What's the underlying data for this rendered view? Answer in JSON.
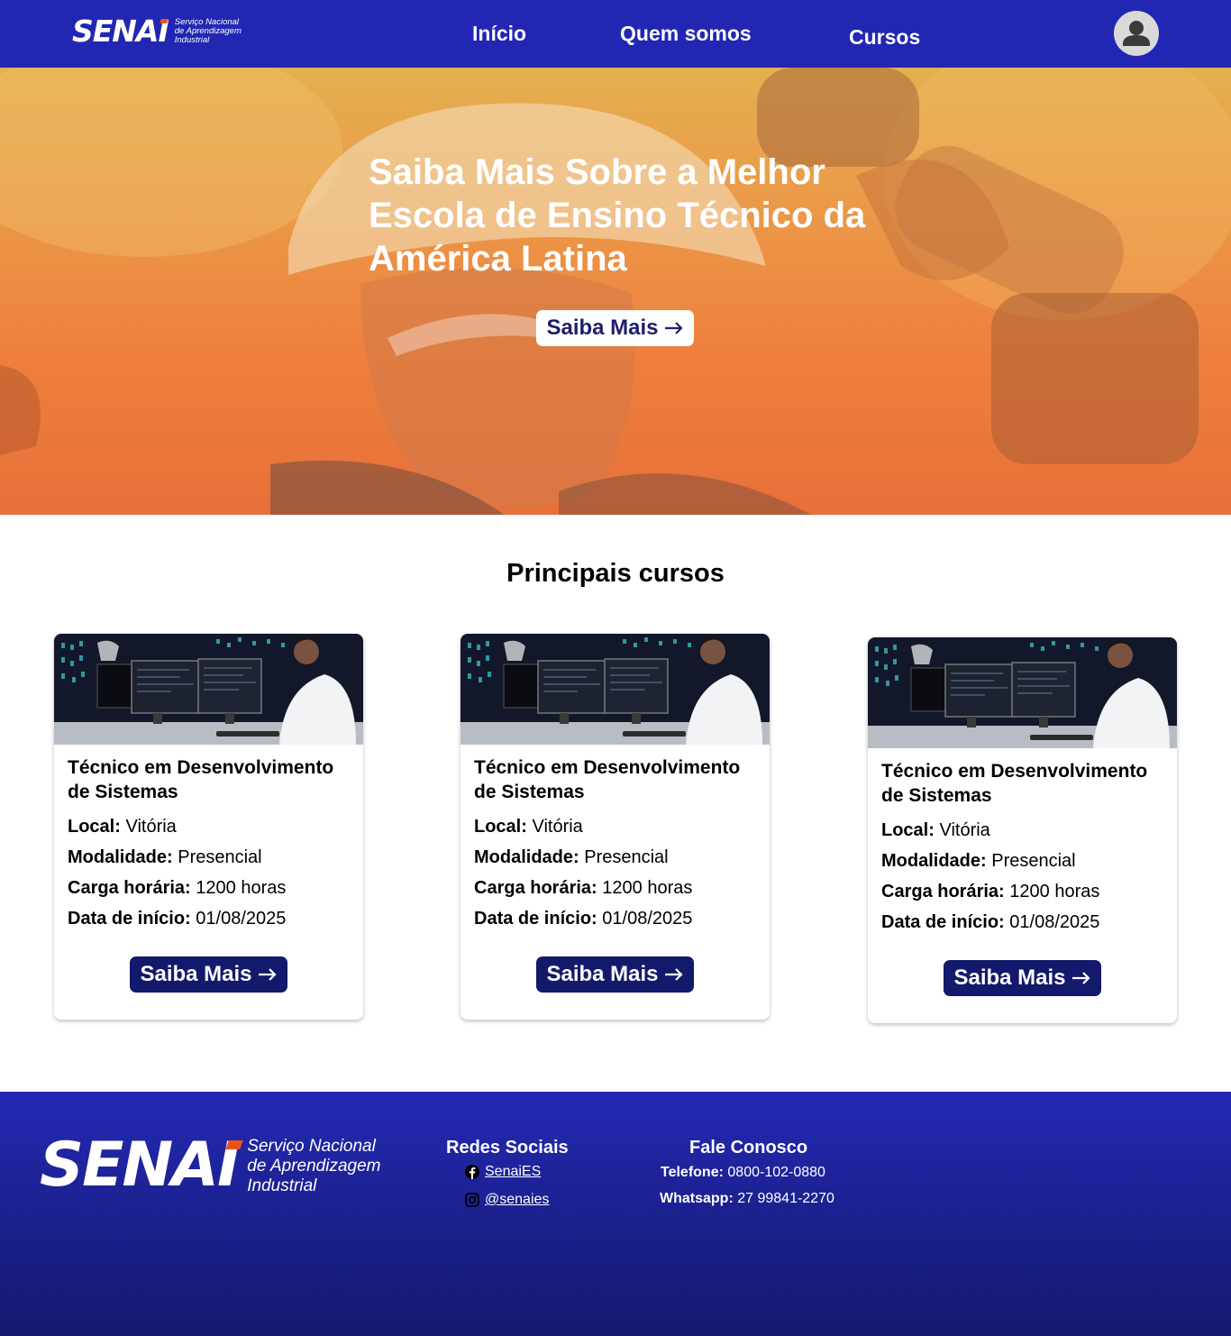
{
  "header": {
    "logo": {
      "word": "SENAI",
      "tagline": [
        "Serviço Nacional",
        "de Aprendizagem",
        "Industrial"
      ]
    },
    "nav": [
      "Início",
      "Quem somos",
      "Cursos"
    ],
    "colors": {
      "header_bg": "#2227b3",
      "logo_accent": "#e8541c"
    }
  },
  "hero": {
    "title": "Saiba Mais Sobre a Melhor Escola de Ensino Técnico da América Latina",
    "button": "Saiba Mais",
    "button_icon": "arrow-right-icon"
  },
  "courses": {
    "title": "Principais cursos",
    "labels": {
      "local": "Local:",
      "modalidade": "Modalidade:",
      "carga": "Carga horária:",
      "inicio": "Data de início:"
    },
    "items": [
      {
        "title": "Técnico em Desenvolvimento de Sistemas",
        "local": "Vitória",
        "modalidade": "Presencial",
        "carga": "1200 horas",
        "inicio": "01/08/2025",
        "button": "Saiba Mais"
      },
      {
        "title": "Técnico em Desenvolvimento de Sistemas",
        "local": "Vitória",
        "modalidade": "Presencial",
        "carga": "1200 horas",
        "inicio": "01/08/2025",
        "button": "Saiba Mais"
      },
      {
        "title": "Técnico em Desenvolvimento de Sistemas",
        "local": "Vitória",
        "modalidade": "Presencial",
        "carga": "1200 horas",
        "inicio": "01/08/2025",
        "button": "Saiba Mais"
      }
    ]
  },
  "footer": {
    "logo": {
      "word": "SENAI",
      "tagline": [
        "Serviço Nacional",
        "de Aprendizagem",
        "Industrial"
      ]
    },
    "social": {
      "title": "Redes Sociais",
      "links": [
        {
          "icon": "facebook-icon",
          "label": "SenaiES"
        },
        {
          "icon": "instagram-icon",
          "label": "@senaies"
        }
      ]
    },
    "contact": {
      "title": "Fale Conosco",
      "phone_label": "Telefone:",
      "phone": "0800-102-0880",
      "whatsapp_label": "Whatsapp:",
      "whatsapp": "27 99841-2270"
    }
  }
}
